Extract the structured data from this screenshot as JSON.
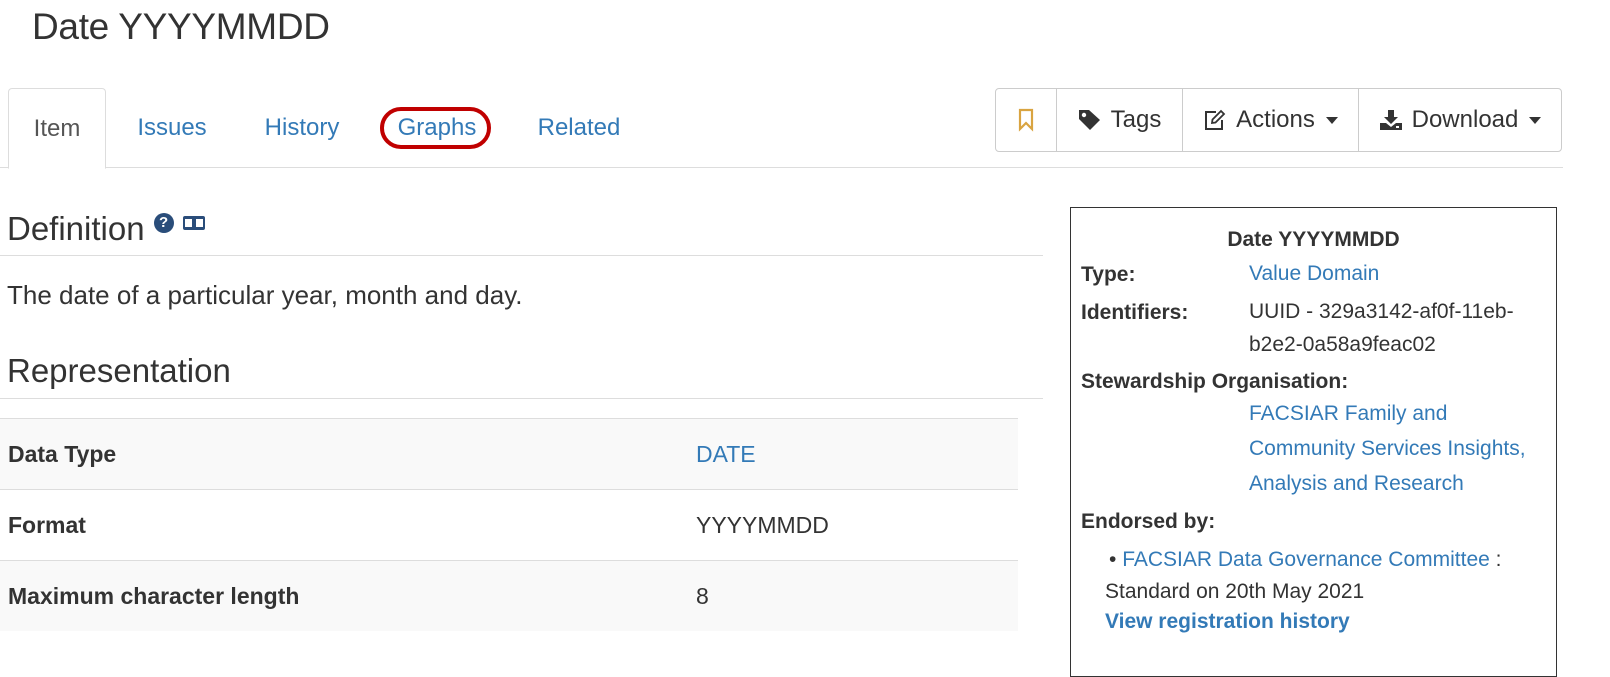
{
  "page": {
    "title": "Date YYYYMMDD"
  },
  "tabs": [
    {
      "label": "Item"
    },
    {
      "label": "Issues"
    },
    {
      "label": "History"
    },
    {
      "label": "Graphs"
    },
    {
      "label": "Related"
    }
  ],
  "active_tab": "Item",
  "highlighted_tab": "Graphs",
  "toolbar": {
    "bookmark_icon": "bookmark-icon",
    "tags_label": "Tags",
    "actions_label": "Actions",
    "download_label": "Download"
  },
  "definition": {
    "heading": "Definition",
    "text": "The date of a particular year, month and day."
  },
  "representation": {
    "heading": "Representation",
    "rows": [
      {
        "key": "Data Type",
        "value": "DATE"
      },
      {
        "key": "Format",
        "value": "YYYYMMDD"
      },
      {
        "key": "Maximum character length",
        "value": "8"
      }
    ]
  },
  "summary": {
    "title": "Date YYYYMMDD",
    "type_label": "Type:",
    "type_value": "Value Domain",
    "identifiers_label": "Identifiers:",
    "identifier_line1": "UUID - 329a3142-af0f-11eb-",
    "identifier_line2": "b2e2-0a58a9feac02",
    "steward_label": "Stewardship Organisation:",
    "steward_line1": "FACSIAR Family and",
    "steward_line2": "Community Services Insights,",
    "steward_line3": "Analysis and Research",
    "endorsed_label": "Endorsed by:",
    "endorser": "FACSIAR Data Governance Committee",
    "endorse_sep": " :",
    "endorse_status": "Standard on 20th May 2021",
    "view_history": "View registration history"
  },
  "colors": {
    "link": "#337ab7",
    "highlight": "#c00000",
    "bookmark": "#d9a441"
  }
}
